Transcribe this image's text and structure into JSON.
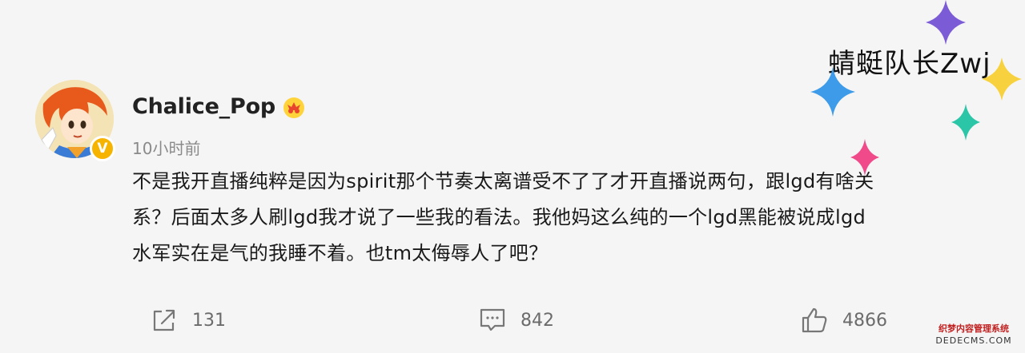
{
  "comment": {
    "username": "Chalice_Pop",
    "timestamp": "10小时前",
    "verified_icon": "v-badge-icon",
    "vip_icon": "crown-badge-icon",
    "content_lines": [
      "不是我开直播纯粹是因为spirit那个节奏太离谱受不了了才开直播说两句，跟lgd有啥关",
      "系？后面太多人刷lgd我才说了一些我的看法。我他妈这么纯的一个lgd黑能被说成lgd",
      "水军实在是气的我睡不着。也tm太侮辱人了吧？"
    ]
  },
  "actions": {
    "share_count": "131",
    "comment_count": "842",
    "like_count": "4866"
  },
  "watermark": {
    "text": "蜻蜓队长Zwj"
  },
  "corner_logo": {
    "line1": "织梦内容管理系统",
    "line2": "DEDECMS.COM"
  },
  "colors": {
    "background": "#f5f5f5",
    "text": "#1a1a1a",
    "muted": "#8a8a8a",
    "verified": "#f6b400",
    "sparkle_purple": "#7b5cd6",
    "sparkle_blue": "#3d9be9",
    "sparkle_pink": "#f04a8a",
    "sparkle_teal": "#2bc6a8",
    "sparkle_yellow": "#f7d23e"
  }
}
